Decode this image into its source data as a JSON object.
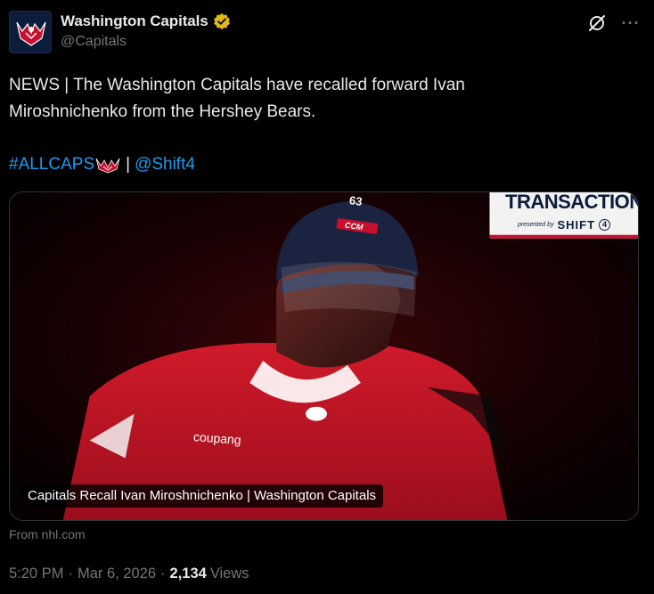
{
  "account": {
    "display_name": "Washington Capitals",
    "handle": "@Capitals",
    "verified_color": "#e2b719",
    "avatar_bg": "#0b1d3b"
  },
  "header_icons": [
    "grok-icon",
    "more-icon"
  ],
  "tweet": {
    "text_line_1": "NEWS | The Washington Capitals have recalled forward Ivan",
    "text_line_2": "Miroshnichenko from the Hershey Bears.",
    "hashtag": "#ALLCAPS",
    "divider": "|",
    "mention": "@Shift4"
  },
  "card": {
    "banner_title": "TRANSACTIONS",
    "banner_presented": "presented by",
    "banner_sponsor": "SHIFT",
    "banner_sponsor_num": "4",
    "helmet_number": "63",
    "helmet_brand": "CCM",
    "jersey_sponsor": "coupang",
    "caption": "Capitals Recall Ivan Miroshnichenko | Washington Capitals",
    "source": "From nhl.com"
  },
  "meta": {
    "time": "5:20 PM",
    "separator": "·",
    "date": "Mar 6, 2026",
    "views_count": "2,134",
    "views_label": "Views"
  },
  "colors": {
    "background": "#000000",
    "text": "#e7e9ea",
    "secondary": "#71767b",
    "link": "#1d9bf0",
    "jersey_red": "#c8102e"
  }
}
